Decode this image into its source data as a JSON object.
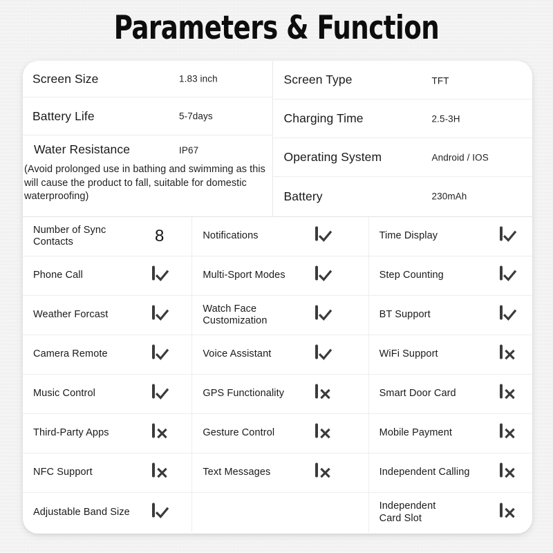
{
  "title": "Parameters & Function",
  "specs": {
    "left": [
      {
        "label": "Screen Size",
        "value": "1.83 inch"
      },
      {
        "label": "Battery Life",
        "value": "5-7days"
      },
      {
        "label": "Water Resistance",
        "value": "IP67",
        "note": "(Avoid prolonged use in bathing and swimming as this will cause the product to fall, suitable for domestic waterproofing)"
      }
    ],
    "right": [
      {
        "label": "Screen Type",
        "value": "TFT"
      },
      {
        "label": "Charging Time",
        "value": "2.5-3H"
      },
      {
        "label": "Operating System",
        "value": "Android / IOS"
      },
      {
        "label": "Battery",
        "value": "230mAh"
      }
    ]
  },
  "features": {
    "column1": [
      {
        "label": "Number of Sync\nContacts",
        "mark": "number",
        "value": "8"
      },
      {
        "label": "Phone Call",
        "mark": "check"
      },
      {
        "label": "Weather Forcast",
        "mark": "check"
      },
      {
        "label": "Camera Remote",
        "mark": "check"
      },
      {
        "label": "Music Control",
        "mark": "check"
      },
      {
        "label": "Third-Party Apps",
        "mark": "cross"
      },
      {
        "label": "NFC Support",
        "mark": "cross"
      },
      {
        "label": "Adjustable Band Size",
        "mark": "check"
      }
    ],
    "column2": [
      {
        "label": "Notifications",
        "mark": "check"
      },
      {
        "label": "Multi-Sport Modes",
        "mark": "check"
      },
      {
        "label": "Watch Face\nCustomization",
        "mark": "check"
      },
      {
        "label": "Voice Assistant",
        "mark": "check"
      },
      {
        "label": "GPS Functionality",
        "mark": "cross"
      },
      {
        "label": "Gesture Control",
        "mark": "cross"
      },
      {
        "label": "Text Messages",
        "mark": "cross"
      },
      {
        "label": "",
        "mark": "none"
      }
    ],
    "column3": [
      {
        "label": "Time Display",
        "mark": "check"
      },
      {
        "label": "Step Counting",
        "mark": "check"
      },
      {
        "label": "BT Support",
        "mark": "check"
      },
      {
        "label": "WiFi Support",
        "mark": "cross"
      },
      {
        "label": "Smart Door Card",
        "mark": "cross"
      },
      {
        "label": "Mobile Payment",
        "mark": "cross"
      },
      {
        "label": "Independent Calling",
        "mark": "cross"
      },
      {
        "label": "Independent\nCard Slot",
        "mark": "cross"
      }
    ]
  },
  "colors": {
    "background": "#f2f2f2",
    "card": "#ffffff",
    "text": "#1a1a1a",
    "mark": "#3b3b3b",
    "divider": "#ededed"
  }
}
